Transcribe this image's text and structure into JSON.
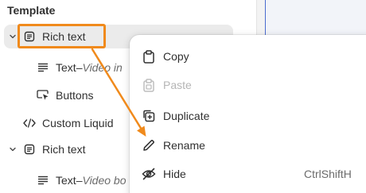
{
  "panel": {
    "section_title": "Template",
    "tree": [
      {
        "name": "rich-text-1",
        "label": "Rich text",
        "chevron": "chevron-down"
      },
      {
        "name": "text-1",
        "label": "Text",
        "separator": " – ",
        "subtitle": "Video in"
      },
      {
        "name": "buttons-1",
        "label": "Buttons"
      },
      {
        "name": "custom-liquid",
        "label": "Custom Liquid"
      },
      {
        "name": "rich-text-2",
        "label": "Rich text",
        "chevron": "chevron-down"
      },
      {
        "name": "text-2",
        "label": "Text",
        "separator": " – ",
        "subtitle": "Video bo"
      }
    ]
  },
  "context_menu": {
    "items": [
      {
        "label": "Copy",
        "icon": "clipboard-icon",
        "disabled": false
      },
      {
        "label": "Paste",
        "icon": "paste-icon",
        "disabled": true
      },
      {
        "label": "Duplicate",
        "icon": "duplicate-icon",
        "disabled": false
      },
      {
        "label": "Rename",
        "icon": "pencil-icon",
        "disabled": false
      },
      {
        "label": "Hide",
        "icon": "eye-off-icon",
        "disabled": false,
        "shortcut": "CtrlShiftH"
      }
    ]
  },
  "colors": {
    "accent_orange": "#f08a1c",
    "selected_row": "#ebebeb",
    "canvas_border": "#4b6ccf"
  }
}
